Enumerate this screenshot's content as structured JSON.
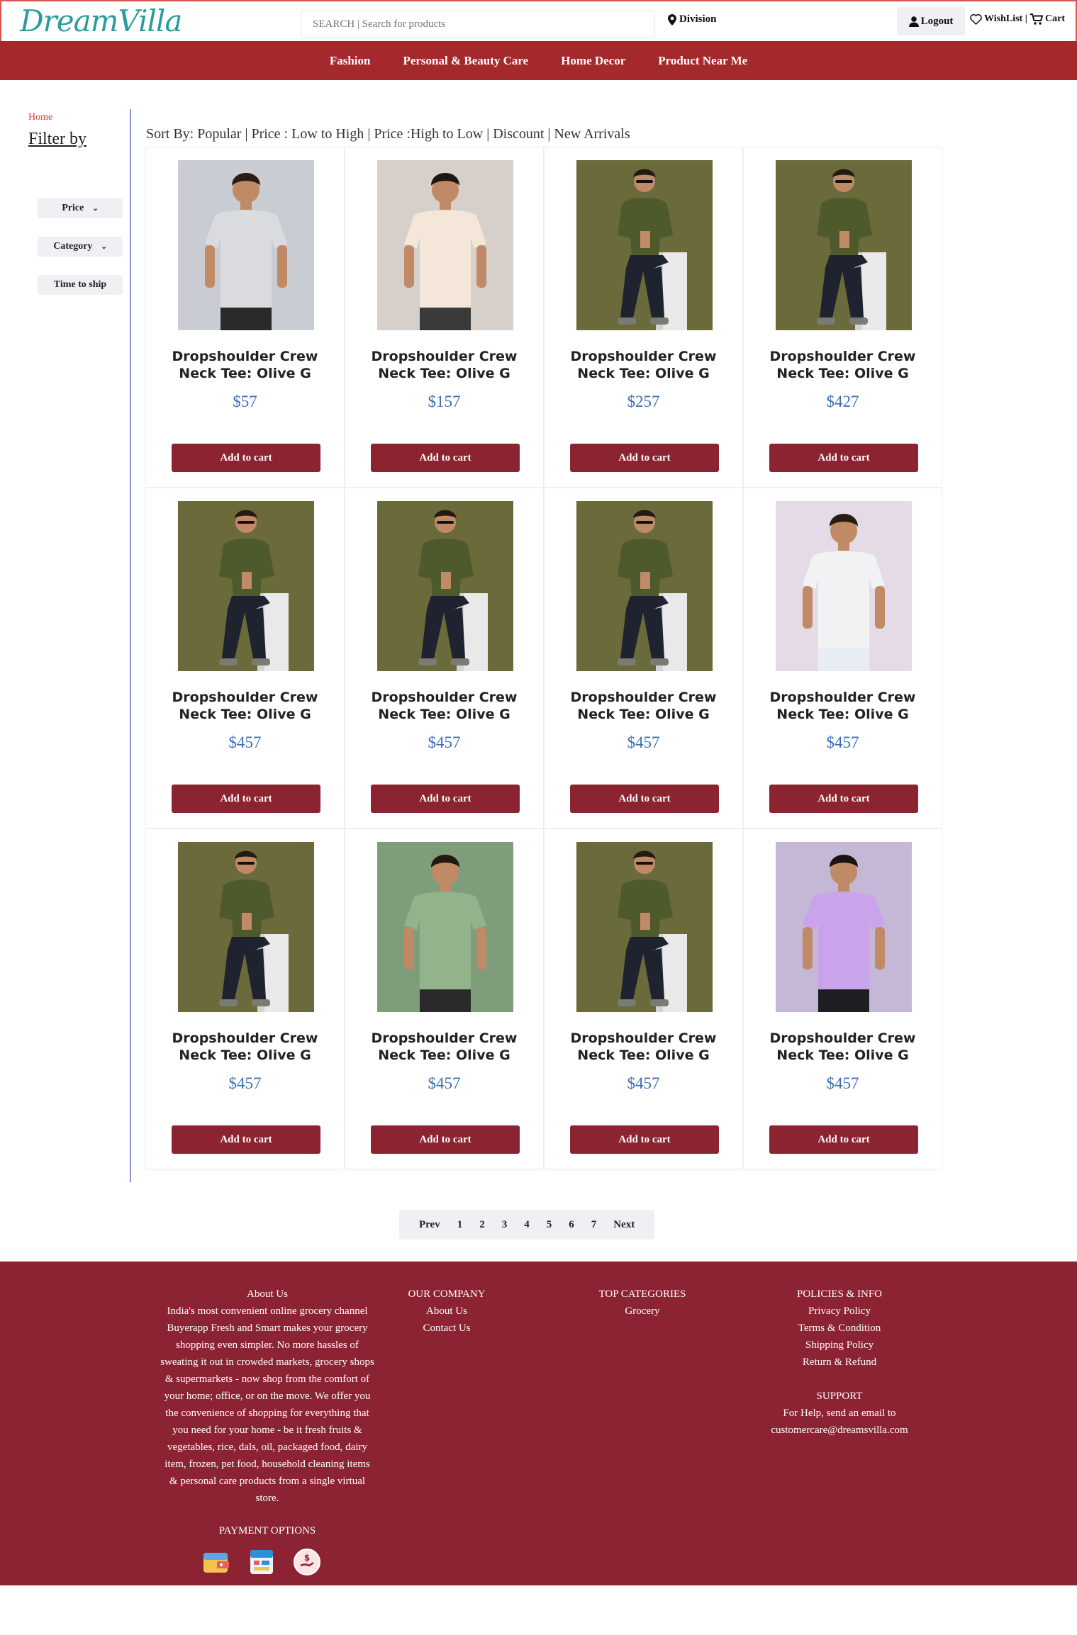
{
  "header": {
    "logo_text": "DreamVilla",
    "search_placeholder": "SEARCH | Search for products",
    "division_label": "Division",
    "logout_label": "Logout",
    "wishlist_label": "WishList |",
    "cart_label": "Cart"
  },
  "nav": {
    "items": [
      "Fashion",
      "Personal & Beauty Care",
      "Home Decor",
      "Product Near Me"
    ]
  },
  "sidebar": {
    "breadcrumb": "Home",
    "title": "Filter by",
    "filters": [
      "Price",
      "Category",
      "Time to ship"
    ]
  },
  "sort": {
    "text": "Sort By: Popular | Price : Low to High | Price :High to Low | Discount | New Arrivals"
  },
  "products": [
    {
      "name": "Dropshoulder Crew Neck Tee: Olive G",
      "price": "$57",
      "image": "grey-tee-model",
      "add_label": "Add to cart"
    },
    {
      "name": "Dropshoulder Crew Neck Tee: Olive G",
      "price": "$157",
      "image": "cream-tee-model",
      "add_label": "Add to cart"
    },
    {
      "name": "Dropshoulder Crew Neck Tee: Olive G",
      "price": "$257",
      "image": "olive-tee-seated-model",
      "add_label": "Add to cart"
    },
    {
      "name": "Dropshoulder Crew Neck Tee: Olive G",
      "price": "$427",
      "image": "olive-tee-seated-model",
      "add_label": "Add to cart"
    },
    {
      "name": "Dropshoulder Crew Neck Tee: Olive G",
      "price": "$457",
      "image": "olive-tee-seated-model",
      "add_label": "Add to cart"
    },
    {
      "name": "Dropshoulder Crew Neck Tee: Olive G",
      "price": "$457",
      "image": "olive-tee-seated-model",
      "add_label": "Add to cart"
    },
    {
      "name": "Dropshoulder Crew Neck Tee: Olive G",
      "price": "$457",
      "image": "olive-tee-seated-model",
      "add_label": "Add to cart"
    },
    {
      "name": "Dropshoulder Crew Neck Tee: Olive G",
      "price": "$457",
      "image": "white-tee-model",
      "add_label": "Add to cart"
    },
    {
      "name": "Dropshoulder Crew Neck Tee: Olive G",
      "price": "$457",
      "image": "olive-tee-seated-model",
      "add_label": "Add to cart"
    },
    {
      "name": "Dropshoulder Crew Neck Tee: Olive G",
      "price": "$457",
      "image": "sage-tee-model",
      "add_label": "Add to cart"
    },
    {
      "name": "Dropshoulder Crew Neck Tee: Olive G",
      "price": "$457",
      "image": "olive-tee-seated-model",
      "add_label": "Add to cart"
    },
    {
      "name": "Dropshoulder Crew Neck Tee: Olive G",
      "price": "$457",
      "image": "lavender-tee-model",
      "add_label": "Add to cart"
    }
  ],
  "pagination": {
    "prev": "Prev",
    "pages": [
      "1",
      "2",
      "3",
      "4",
      "5",
      "6",
      "7"
    ],
    "next": "Next"
  },
  "footer": {
    "about_title": "About Us",
    "about_text": "India's most convenient online grocery channel Buyerapp Fresh and Smart makes your grocery shopping even simpler. No more hassles of sweating it out in crowded markets, grocery shops & supermarkets - now shop from the comfort of your home; office, or on the move. We offer you the convenience of shopping for everything that you need for your home - be it fresh fruits & vegetables, rice, dals, oil, packaged food, dairy item, frozen, pet food, household cleaning items & personal care products from a single virtual store.",
    "payment_title": "PAYMENT OPTIONS",
    "payment_icons": [
      "wallet-icon",
      "paytm-icon",
      "cash-on-delivery-icon"
    ],
    "company_title": "OUR COMPANY",
    "company_links": [
      "About Us",
      "Contact Us"
    ],
    "categories_title": "TOP CATEGORIES",
    "categories_links": [
      "Grocery"
    ],
    "policies_title": "POLICIES & INFO",
    "policies_links": [
      "Privacy Policy",
      "Terms & Condition",
      "Shipping Policy",
      "Return & Refund"
    ],
    "support_title": "SUPPORT",
    "support_text": "For Help, send an email to",
    "support_email": "customercare@dreamsvilla.com"
  },
  "colors": {
    "brand_red": "#a4292d",
    "footer_red": "#8c2332",
    "button_red": "#8b2330",
    "price_blue": "#3d6fb6",
    "logo_teal": "#2a9d9a"
  }
}
